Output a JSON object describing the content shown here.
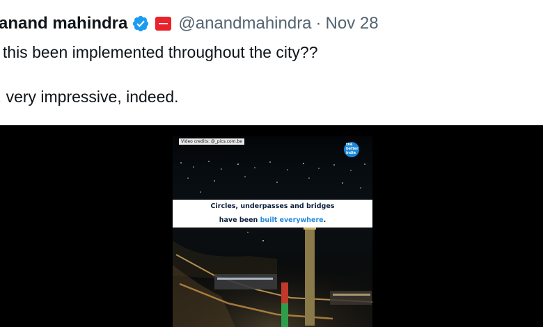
{
  "tweet": {
    "author_name": "anand mahindra",
    "handle": "@anandmahindra",
    "separator": "·",
    "date": "Nov 28",
    "text_line_1": "s this been implemented throughout the city??",
    "text_line_2": "y, very impressive, indeed.",
    "verified_icon": "verified-badge-icon",
    "affiliation_icon": "mahindra-logo-icon",
    "colors": {
      "verified": "#1d9bf0",
      "affiliation": "#e8232b",
      "secondary_text": "#536471"
    }
  },
  "media": {
    "credit": "Video credits: @_pics.com.be",
    "logo_text": "the better india",
    "caption_line_1": "Circles, underpasses and bridges",
    "caption_line_2_before": "have been ",
    "caption_line_2_highlight": "built everywhere",
    "caption_line_2_after": ".",
    "colors": {
      "caption_highlight": "#1f8ae0",
      "caption_text": "#0b1e3c"
    }
  }
}
